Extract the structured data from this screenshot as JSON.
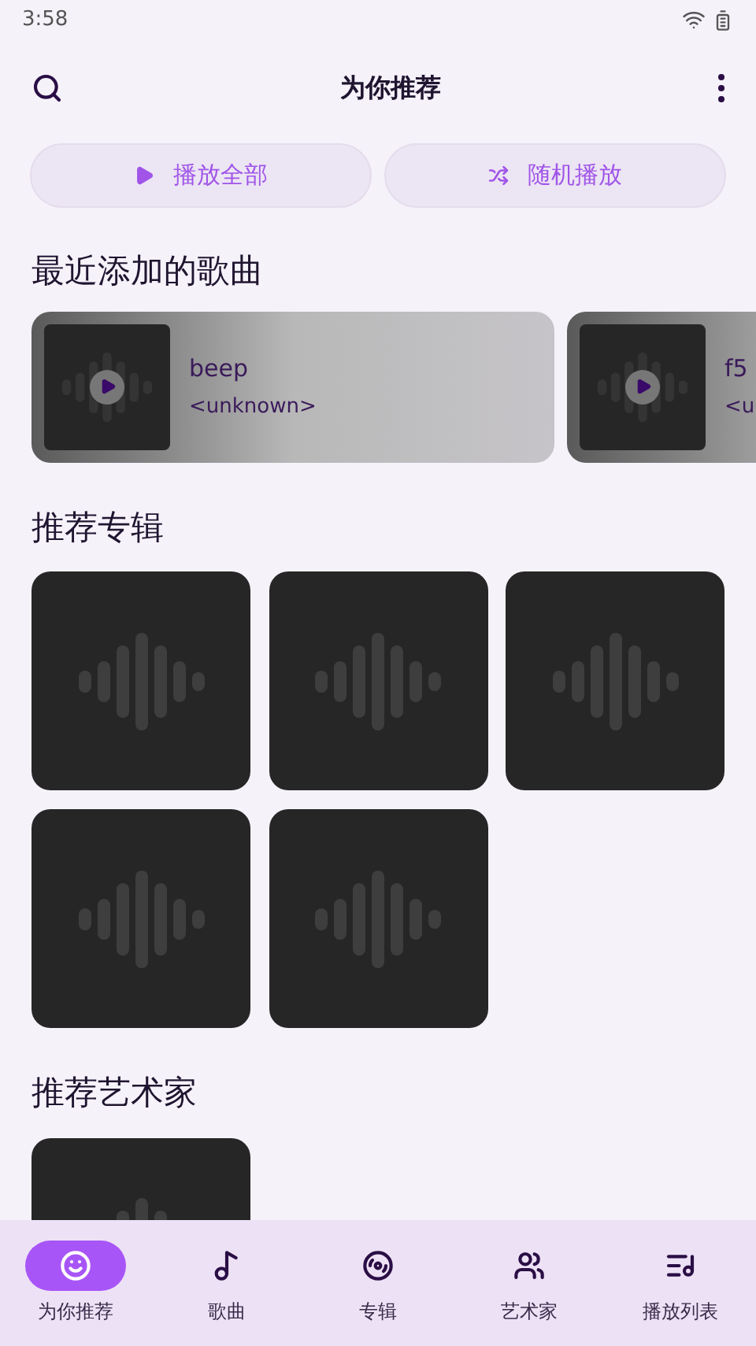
{
  "status_bar": {
    "time": "3:58"
  },
  "app_bar": {
    "title": "为你推荐"
  },
  "actions": [
    {
      "kind": "play",
      "label": "播放全部"
    },
    {
      "kind": "shuffle",
      "label": "随机播放"
    }
  ],
  "recent": {
    "title": "最近添加的歌曲",
    "songs": [
      {
        "title": "beep",
        "artist": "<unknown>"
      },
      {
        "title": "f5",
        "artist": "<u"
      }
    ]
  },
  "albums": {
    "title": "推荐专辑",
    "items": [
      {
        "kind": "placeholder"
      },
      {
        "kind": "placeholder"
      },
      {
        "kind": "placeholder"
      },
      {
        "kind": "placeholder"
      },
      {
        "kind": "placeholder"
      }
    ]
  },
  "artists": {
    "title": "推荐艺术家",
    "items": [
      {
        "kind": "placeholder"
      }
    ]
  },
  "nav": [
    {
      "kind": "face",
      "label": "为你推荐",
      "selected": true
    },
    {
      "kind": "note",
      "label": "歌曲",
      "selected": false
    },
    {
      "kind": "disc",
      "label": "专辑",
      "selected": false
    },
    {
      "kind": "people",
      "label": "艺术家",
      "selected": false
    },
    {
      "kind": "playlist",
      "label": "播放列表",
      "selected": false
    }
  ]
}
